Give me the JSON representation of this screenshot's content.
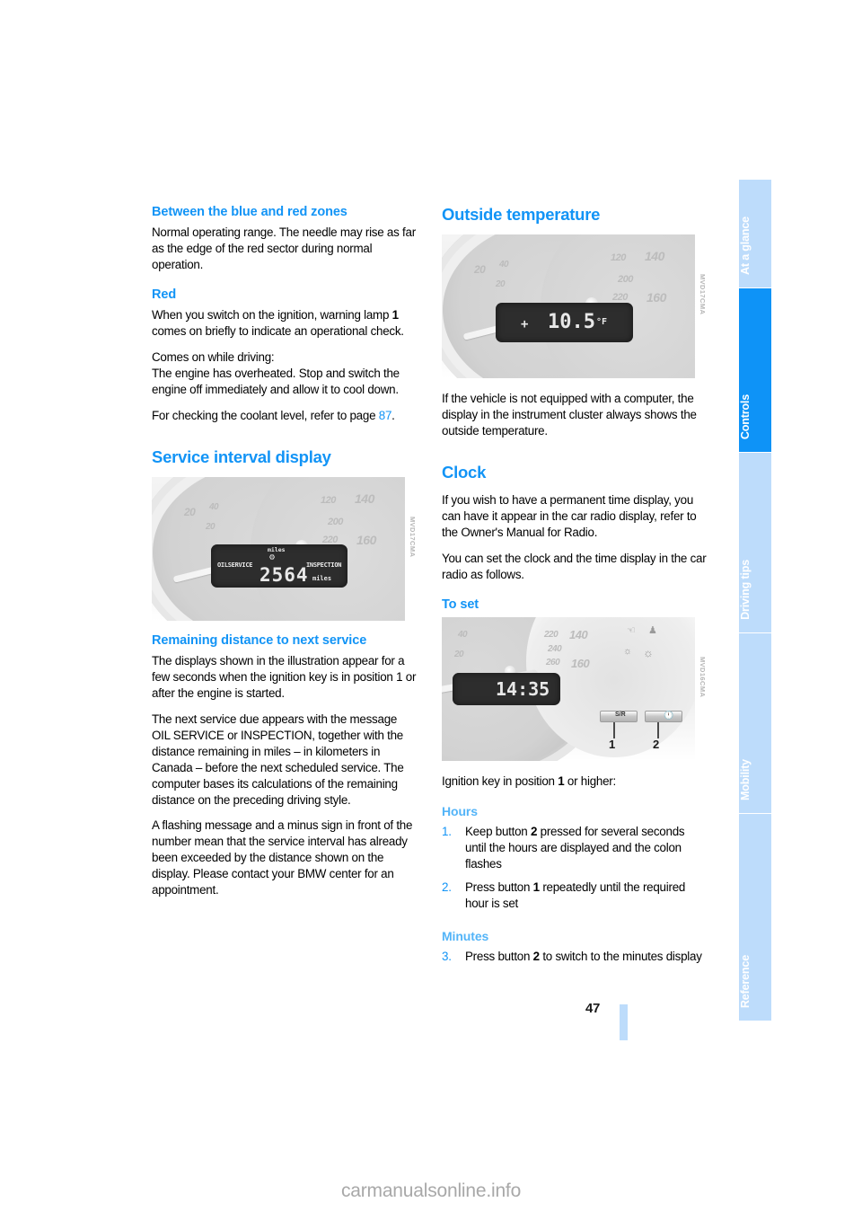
{
  "document": {
    "page_number": "47",
    "watermark": "carmanualsonline.info"
  },
  "sidebar": {
    "tabs": [
      {
        "label": "At a glance",
        "active": false
      },
      {
        "label": "Controls",
        "active": true
      },
      {
        "label": "Driving tips",
        "active": false
      },
      {
        "label": "Mobility",
        "active": false
      },
      {
        "label": "Reference",
        "active": false
      }
    ]
  },
  "left_column": {
    "heading_between": "Between the blue and red zones",
    "para_between": "Normal operating range. The needle may rise as far as the edge of the red sector during normal operation.",
    "heading_red": "Red",
    "para_red_1_a": "When you switch on the ignition, warning lamp ",
    "para_red_1_b": "1",
    "para_red_1_c": " comes on briefly to indicate an operational check.",
    "para_red_2": "Comes on while driving:",
    "para_red_3": "The engine has overheated. Stop and switch the engine off immediately and allow it to cool down.",
    "para_red_4_a": "For checking the coolant level, refer to page ",
    "para_red_4_ref": "87",
    "para_red_4_b": ".",
    "heading_service": "Service interval display",
    "figure_service": {
      "lcd_left_label": "OILSERVICE",
      "lcd_right_label": "INSPECTION",
      "lcd_top_unit": "miles",
      "lcd_value": "2564",
      "lcd_bottom_unit": "miles",
      "dial_ticks": [
        "20",
        "40",
        "20",
        "120",
        "140",
        "200",
        "220",
        "160"
      ],
      "code": "MVD17CMA"
    },
    "heading_remaining": "Remaining distance to next service",
    "para_remaining_1": "The displays shown in the illustration appear for a few seconds when the ignition key is in position 1 or after the engine is started.",
    "para_remaining_2": "The next service due appears with the message OIL SERVICE or INSPECTION, together with the distance remaining in miles – in kilometers in Canada – before the next scheduled service. The computer bases its calculations of the remaining distance on the preceding driving style.",
    "para_remaining_3": "A flashing message and a minus sign in front of the number mean that the service interval has already been exceeded by the distance shown on the display. Please contact your BMW center for an appointment."
  },
  "right_column": {
    "heading_outside_temp": "Outside temperature",
    "figure_outside_temp": {
      "lcd_sign": "+",
      "lcd_value": "10.5",
      "lcd_unit": "°F",
      "dial_ticks": [
        "20",
        "40",
        "20",
        "120",
        "140",
        "200",
        "220",
        "160"
      ],
      "code": "MVD17CMA"
    },
    "para_outside_temp": "If the vehicle is not equipped with a computer, the display in the instrument cluster always shows the outside temperature.",
    "heading_clock": "Clock",
    "para_clock_1": "If you wish to have a permanent time display, you can have it appear in the car radio display, refer to the Owner's Manual for Radio.",
    "para_clock_2": "You can set the clock and the time display in the car radio as follows.",
    "heading_to_set": "To set",
    "figure_clock": {
      "lcd_value": "14:35",
      "button_1_label": "S/R",
      "button_2_label": "clock-icon",
      "callout_1": "1",
      "callout_2": "2",
      "dial_ticks": [
        "40",
        "20",
        "220",
        "140",
        "240",
        "260",
        "160"
      ],
      "code": "MVD16CMA"
    },
    "para_ignition_a": "Ignition key in position ",
    "para_ignition_b": "1",
    "para_ignition_c": " or higher:",
    "heading_hours": "Hours",
    "steps_hours": [
      {
        "num": "1.",
        "text_a": "Keep button ",
        "bold": "2",
        "text_b": " pressed for several seconds until the hours are displayed and the colon flashes"
      },
      {
        "num": "2.",
        "text_a": "Press button ",
        "bold": "1",
        "text_b": " repeatedly until the required hour is set"
      }
    ],
    "heading_minutes": "Minutes",
    "steps_minutes": [
      {
        "num": "3.",
        "text_a": "Press button ",
        "bold": "2",
        "text_b": " to switch to the minutes display"
      }
    ]
  },
  "colors": {
    "accent_blue": "#1294f6",
    "light_blue": "#53b4f8",
    "tab_inactive": "#bddcfb",
    "tab_active": "#0e93f7"
  }
}
